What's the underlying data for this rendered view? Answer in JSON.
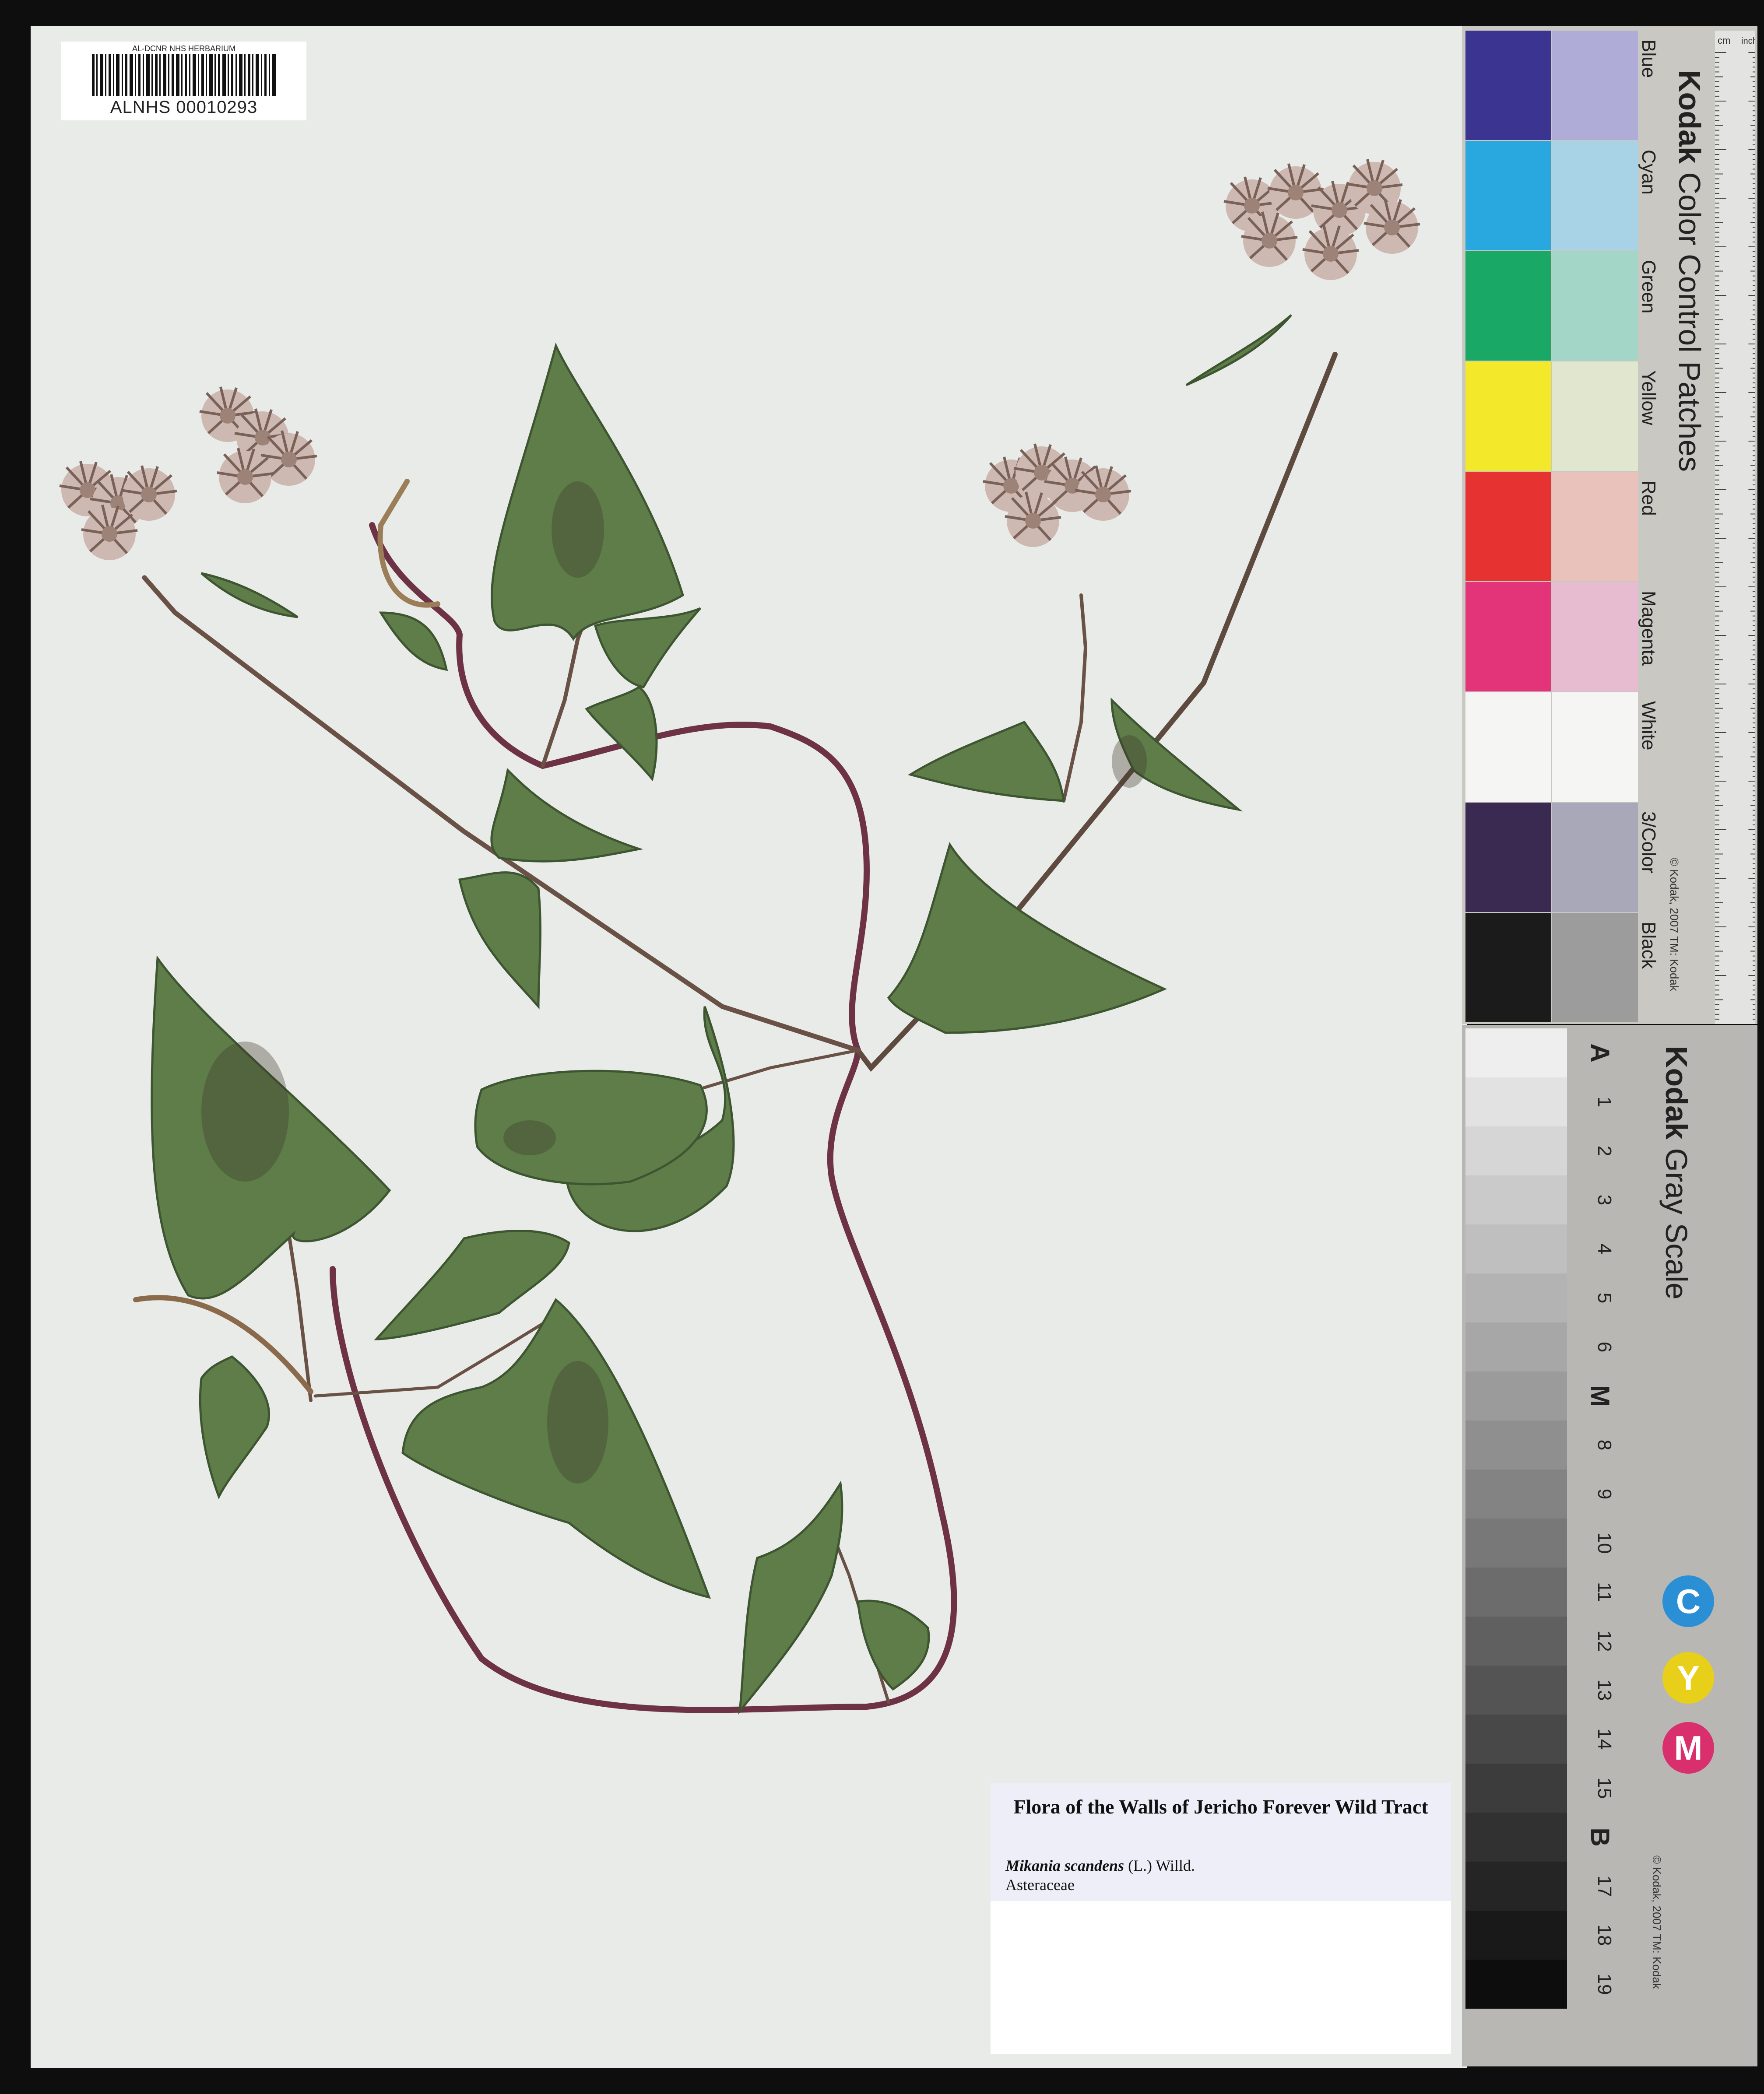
{
  "barcode": {
    "institution": "AL-DCNR NHS HERBARIUM",
    "catalog_number": "ALNHS 00010293"
  },
  "label": {
    "title": "Flora of the Walls of Jericho Forever Wild Tract",
    "species_name": "Mikania scandens",
    "species_author": "(L.) Willd.",
    "family": "Asteraceae"
  },
  "color_card": {
    "brand": "Kodak",
    "title": "Color Control Patches",
    "copyright": "© Kodak, 2007 TM: Kodak",
    "ruler_units": [
      "cm",
      "inches"
    ],
    "patches": [
      {
        "name": "Blue",
        "dark": "#3b3591",
        "light": "#b0acd8"
      },
      {
        "name": "Cyan",
        "dark": "#29a7df",
        "light": "#a8d3e6"
      },
      {
        "name": "Green",
        "dark": "#1aa866",
        "light": "#a4d6c8"
      },
      {
        "name": "Yellow",
        "dark": "#f4e82a",
        "light": "#e1e6cf"
      },
      {
        "name": "Red",
        "dark": "#e63230",
        "light": "#eac2bc"
      },
      {
        "name": "Magenta",
        "dark": "#e3347a",
        "light": "#e8bcd0"
      },
      {
        "name": "White",
        "dark": "#f5f5f3",
        "light": "#f5f5f3"
      },
      {
        "name": "3/Color",
        "dark": "#3a2a52",
        "light": "#a9a8b8"
      },
      {
        "name": "Black",
        "dark": "#1b1b1b",
        "light": "#9c9c9c"
      }
    ]
  },
  "gray_scale": {
    "brand": "Kodak",
    "title": "Gray Scale",
    "copyright": "© Kodak, 2007 TM: Kodak",
    "steps": [
      "A",
      "1",
      "2",
      "3",
      "4",
      "5",
      "6",
      "M",
      "8",
      "9",
      "10",
      "11",
      "12",
      "13",
      "14",
      "15",
      "B",
      "17",
      "18",
      "19"
    ],
    "cmy": [
      "C",
      "Y",
      "M"
    ]
  }
}
